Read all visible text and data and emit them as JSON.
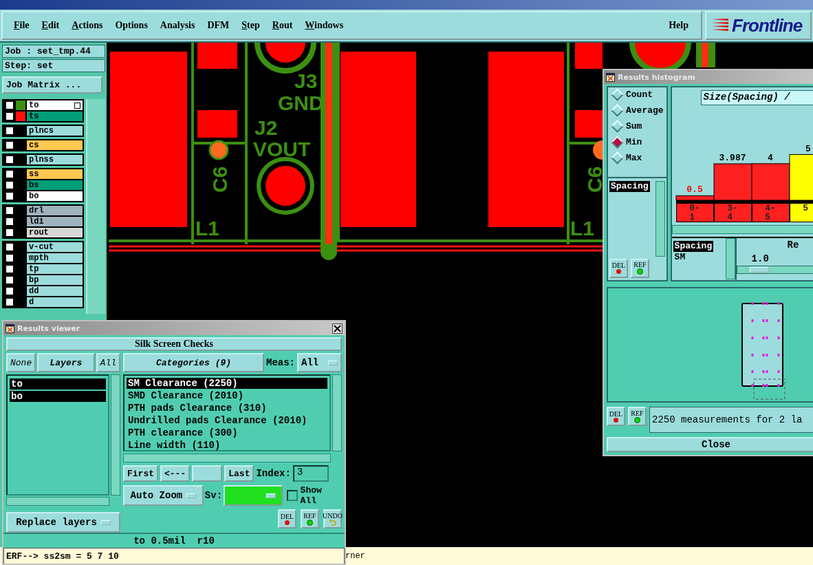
{
  "menu": [
    {
      "label": "File",
      "underlined": true
    },
    {
      "label": "Edit",
      "underlined": true
    },
    {
      "label": "Actions",
      "underlined": true
    },
    {
      "label": "Options",
      "underlined": false
    },
    {
      "label": "Analysis",
      "underlined": false
    },
    {
      "label": "DFM",
      "underlined": false
    },
    {
      "label": "Step",
      "underlined": true
    },
    {
      "label": "Rout",
      "underlined": true
    },
    {
      "label": "Windows",
      "underlined": true
    }
  ],
  "help": "Help",
  "logo": "Frontline",
  "job": "Job : set_tmp.44",
  "step": "Step: set",
  "job_matrix": "Job Matrix ...",
  "layer_groups": [
    [
      {
        "name": "to",
        "color": "#ffffff",
        "swatch": {
          "color": "#3c9010"
        },
        "checked": false,
        "has_menu": true
      },
      {
        "name": "ts",
        "color": "#009e78",
        "swatch": {
          "color": "#ff1010"
        },
        "checked": false,
        "has_menu": false
      }
    ],
    [
      {
        "name": "plncs",
        "color": "#9ddcdc",
        "checked": false,
        "has_menu": false
      }
    ],
    [
      {
        "name": "cs",
        "color": "#ffc850",
        "checked": false,
        "has_menu": false
      }
    ],
    [
      {
        "name": "plnss",
        "color": "#9ddcdc",
        "checked": false,
        "has_menu": false
      }
    ],
    [
      {
        "name": "ss",
        "color": "#ffc850",
        "checked": false,
        "has_menu": false
      },
      {
        "name": "bs",
        "color": "#009e78",
        "checked": false,
        "has_menu": false
      },
      {
        "name": "bo",
        "color": "#ffffff",
        "checked": false,
        "has_menu": false
      }
    ],
    [
      {
        "name": "drl",
        "color": "#9fb3be",
        "checked": false,
        "has_menu": false
      },
      {
        "name": "ldi",
        "color": "#9fb3be",
        "checked": false,
        "has_menu": false
      },
      {
        "name": "rout",
        "color": "#d8d8d8",
        "checked": false,
        "has_menu": false
      }
    ],
    [
      {
        "name": "v-cut",
        "color": "#9ddcdc",
        "checked": false,
        "has_menu": false
      },
      {
        "name": "mpth",
        "color": "#9ddcdc",
        "checked": false,
        "has_menu": false
      },
      {
        "name": "tp",
        "color": "#9ddcdc",
        "checked": false,
        "has_menu": false
      },
      {
        "name": "bp",
        "color": "#9ddcdc",
        "checked": false,
        "has_menu": false
      },
      {
        "name": "dd",
        "color": "#9ddcdc",
        "checked": false,
        "has_menu": false
      },
      {
        "name": "d",
        "color": "#9ddcdc",
        "checked": false,
        "has_menu": false
      }
    ]
  ],
  "canvas": {
    "labels": [
      {
        "text": "J3"
      },
      {
        "text": "GND"
      },
      {
        "text": "J2"
      },
      {
        "text": "VOUT"
      },
      {
        "text": "C6"
      },
      {
        "text": "L1"
      },
      {
        "text": "C6"
      },
      {
        "text": "L1"
      }
    ]
  },
  "status": "rner",
  "results_viewer": {
    "title": "Results viewer",
    "header": "Silk Screen Checks",
    "layer_tabs": [
      {
        "label": "None",
        "selected": false
      },
      {
        "label": "Layers",
        "selected": true
      },
      {
        "label": "All",
        "selected": false
      }
    ],
    "layers": [
      {
        "name": "to",
        "selected": true
      },
      {
        "name": "bo",
        "selected": true
      }
    ],
    "replace": "Replace layers",
    "categories_button": "Categories (9)",
    "meas_label": "Meas:",
    "meas_value": "All",
    "categories": [
      {
        "label": "SM Clearance (2250)",
        "selected": true
      },
      {
        "label": "SMD Clearance (2010)",
        "selected": false
      },
      {
        "label": "PTH pads Clearance (310)",
        "selected": false
      },
      {
        "label": "Undrilled pads Clearance (2010)",
        "selected": false
      },
      {
        "label": "PTH clearance (300)",
        "selected": false
      },
      {
        "label": "Line width (110)",
        "selected": false
      }
    ],
    "nav_left": [
      "First",
      "<---"
    ],
    "nav_right": [
      "Last"
    ],
    "index_label": "Index:",
    "index_value": "3",
    "zoom": "Auto Zoom",
    "sv_label": "Sv:",
    "show_all": {
      "label": "Show All",
      "checked": false
    },
    "actions": [
      {
        "label": "DEL",
        "kind": "delete"
      },
      {
        "label": "REF",
        "kind": "refresh"
      },
      {
        "label": "UNDO",
        "kind": "undo"
      }
    ],
    "info": "to 0.5mil  r10",
    "command": "ERF--> ss2sm = 5 7 10"
  },
  "histogram": {
    "title": "Results histogram",
    "modes": [
      {
        "label": "Count",
        "selected": false
      },
      {
        "label": "Average",
        "selected": false
      },
      {
        "label": "Sum",
        "selected": false
      },
      {
        "label": "Min",
        "selected": true
      },
      {
        "label": "Max",
        "selected": false
      }
    ],
    "attributes": [
      {
        "label": "Spacing",
        "selected": true
      }
    ],
    "actions": [
      {
        "label": "DEL",
        "kind": "delete"
      },
      {
        "label": "REF",
        "kind": "refresh"
      }
    ],
    "chart_data": {
      "type": "bar",
      "title": "Size(Spacing) /",
      "categories": [
        "0-1",
        "3-4",
        "4-5",
        "5"
      ],
      "values": [
        0.5,
        3.987,
        4,
        5
      ],
      "data_labels": true
    },
    "filters": [
      {
        "label": "Spacing",
        "selected": true
      },
      {
        "label": "SM",
        "selected": false
      }
    ],
    "range": {
      "label": "Re",
      "value": "1.0"
    },
    "bottom_actions": [
      {
        "label": "DEL",
        "kind": "delete"
      },
      {
        "label": "REF",
        "kind": "refresh"
      }
    ],
    "message": "2250 measurements for 2 la",
    "close": "Close"
  }
}
